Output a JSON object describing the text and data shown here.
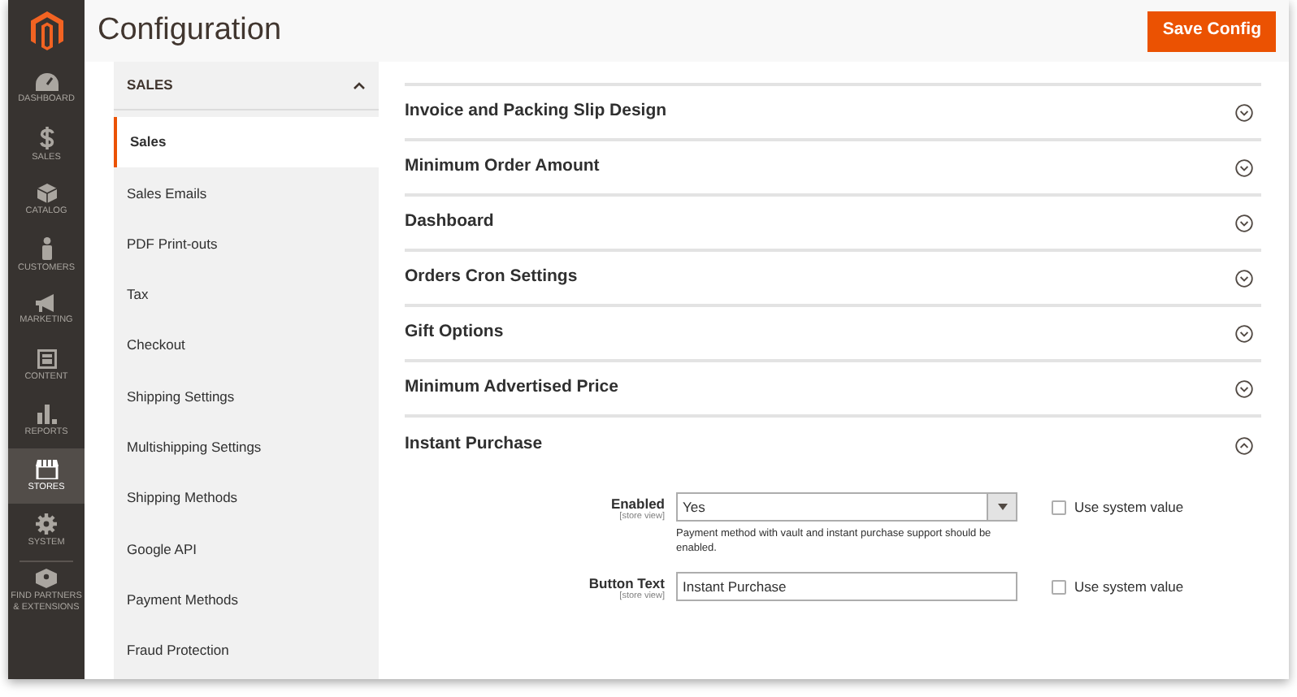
{
  "nav": [
    {
      "label": "DASHBOARD",
      "selected": false
    },
    {
      "label": "SALES",
      "selected": false
    },
    {
      "label": "CATALOG",
      "selected": false
    },
    {
      "label": "CUSTOMERS",
      "selected": false
    },
    {
      "label": "MARKETING",
      "selected": false
    },
    {
      "label": "CONTENT",
      "selected": false
    },
    {
      "label": "REPORTS",
      "selected": false
    },
    {
      "label": "STORES",
      "selected": true
    },
    {
      "label": "SYSTEM",
      "selected": false
    },
    {
      "label": "FIND PARTNERS & EXTENSIONS",
      "selected": false
    }
  ],
  "page_title": "Configuration",
  "save_button": "Save Config",
  "config_tabs": {
    "title": "SALES",
    "expanded": true,
    "items": [
      {
        "label": "Sales",
        "selected": true
      },
      {
        "label": "Sales Emails",
        "selected": false
      },
      {
        "label": "PDF Print-outs",
        "selected": false
      },
      {
        "label": "Tax",
        "selected": false
      },
      {
        "label": "Checkout",
        "selected": false
      },
      {
        "label": "Shipping Settings",
        "selected": false
      },
      {
        "label": "Multishipping Settings",
        "selected": false
      },
      {
        "label": "Shipping Methods",
        "selected": false
      },
      {
        "label": "Google API",
        "selected": false
      },
      {
        "label": "Payment Methods",
        "selected": false
      },
      {
        "label": "Fraud Protection",
        "selected": false
      }
    ]
  },
  "sections": [
    {
      "title": "Invoice and Packing Slip Design",
      "expanded": false
    },
    {
      "title": "Minimum Order Amount",
      "expanded": false
    },
    {
      "title": "Dashboard",
      "expanded": false
    },
    {
      "title": "Orders Cron Settings",
      "expanded": false
    },
    {
      "title": "Gift Options",
      "expanded": false
    },
    {
      "title": "Minimum Advertised Price",
      "expanded": false
    },
    {
      "title": "Instant Purchase",
      "expanded": true
    }
  ],
  "fields": [
    {
      "kind": "select",
      "label": "Enabled",
      "scope": "[store view]",
      "value": "Yes",
      "note": "Payment method with vault and instant purchase support should be enabled.",
      "use_system_value": {
        "label": "Use system value",
        "checked": false
      }
    },
    {
      "kind": "text",
      "label": "Button Text",
      "scope": "[store view]",
      "value": "Instant Purchase",
      "use_system_value": {
        "label": "Use system value",
        "checked": false
      }
    }
  ]
}
